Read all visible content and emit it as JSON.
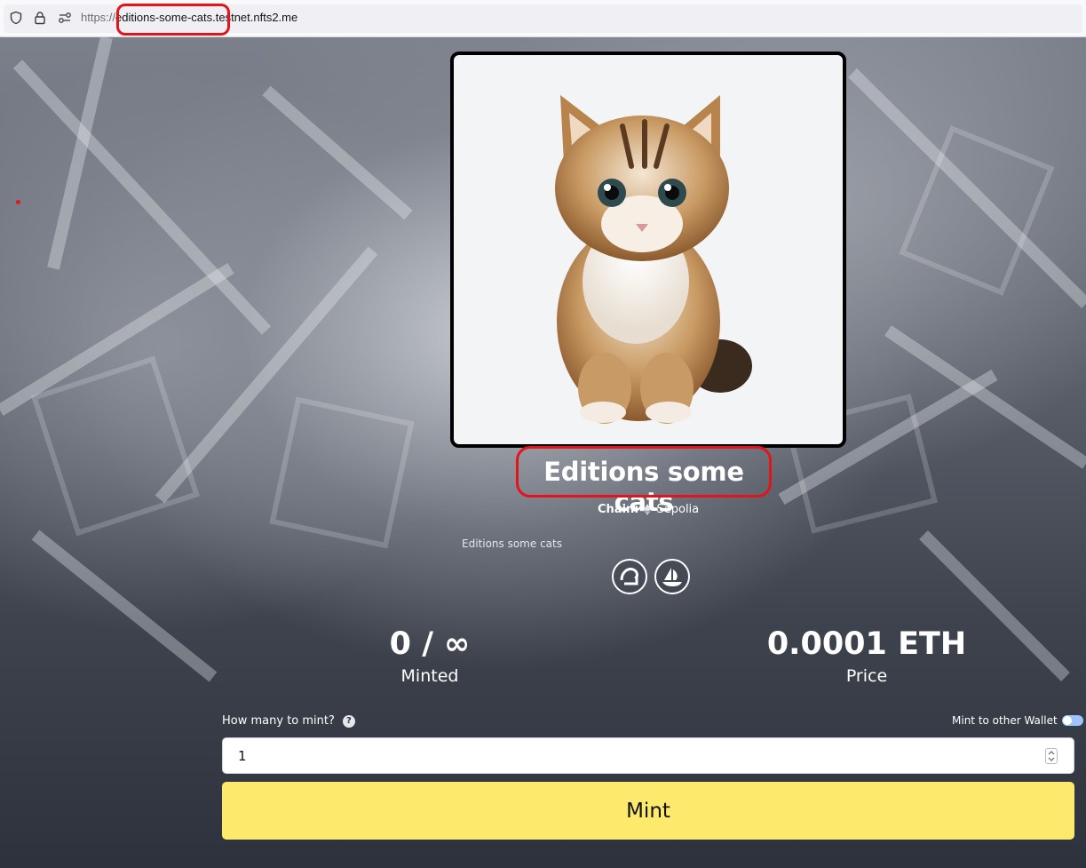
{
  "browser": {
    "url_scheme": "https://",
    "url_rest": "editions-some-cats.testnet.nfts2.me",
    "icons": [
      "shield-icon",
      "lock-icon",
      "permissions-icon"
    ]
  },
  "collection": {
    "title": "Editions some cats",
    "chain_label": "Chain:",
    "chain_name": "Sepolia",
    "description": "Editions some cats",
    "image": "kitten-image",
    "marketplace_icons": [
      "element-market-icon",
      "opensea-icon"
    ]
  },
  "stats": {
    "minted_value": "0 / ∞",
    "minted_label": "Minted",
    "price_value": "0.0001 ETH",
    "price_label": "Price"
  },
  "mint_form": {
    "quantity_label": "How many to mint?",
    "help_icon": "?",
    "other_wallet_label": "Mint to other Wallet",
    "other_wallet_enabled": false,
    "quantity_value": "1",
    "mint_button": "Mint"
  },
  "colors": {
    "mint_button": "#fde96c",
    "annotation": "#e3141b"
  }
}
